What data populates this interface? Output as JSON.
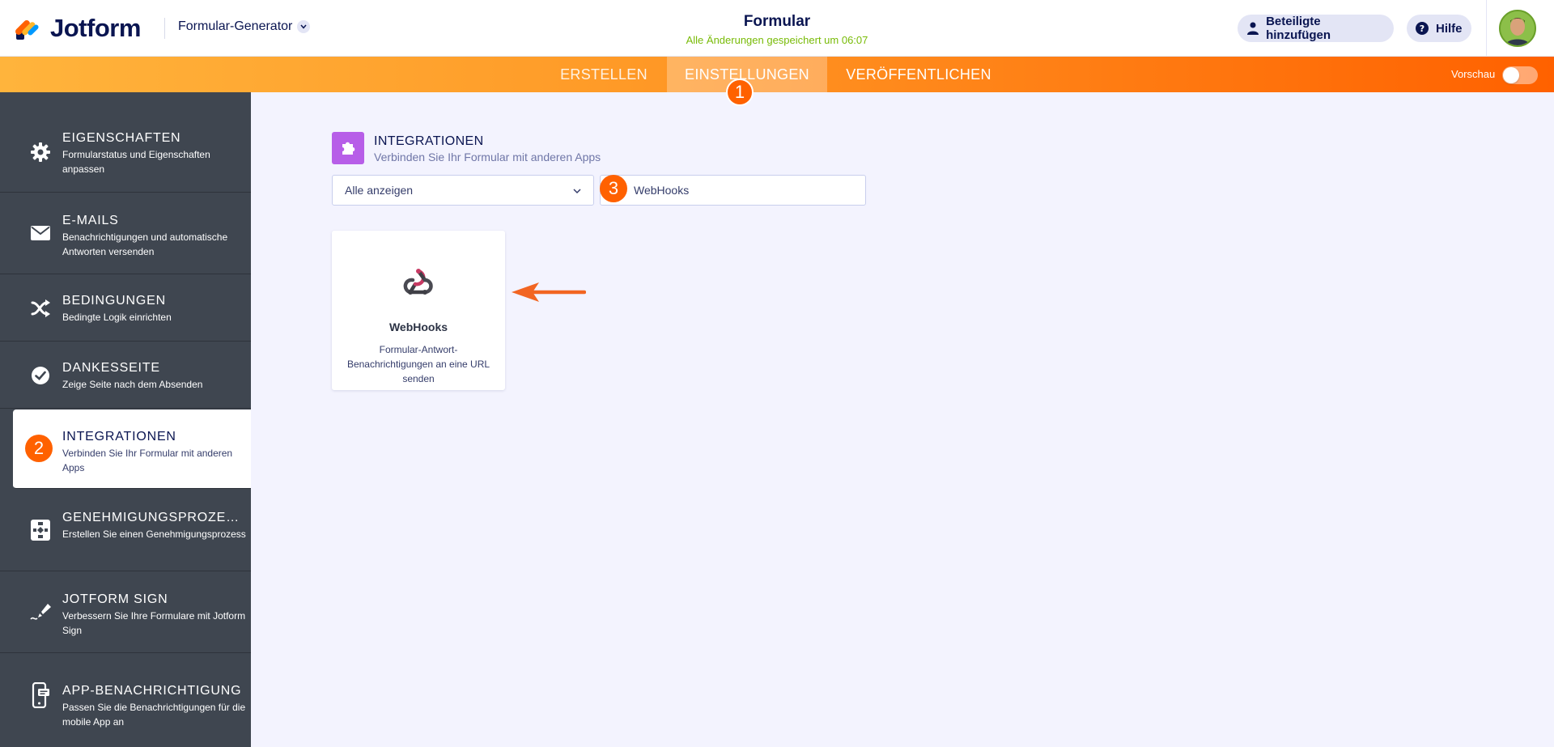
{
  "header": {
    "brand": "Jotform",
    "builder_menu": "Formular-Generator",
    "form_title": "Formular",
    "save_status": "Alle Änderungen gespeichert um 06:07",
    "add_participants": "Beteiligte hinzufügen",
    "help": "Hilfe"
  },
  "nav": {
    "tabs": [
      {
        "label": "ERSTELLEN"
      },
      {
        "label": "EINSTELLUNGEN"
      },
      {
        "label": "VERÖFFENTLICHEN"
      }
    ],
    "active_tab": "EINSTELLUNGEN",
    "preview_label": "Vorschau",
    "preview_on": false
  },
  "annotations": {
    "step1": "1",
    "step2": "2",
    "step3": "3"
  },
  "sidebar": {
    "items": [
      {
        "title": "EIGENSCHAFTEN",
        "desc": "Formularstatus und Eigenschaften anpassen",
        "icon": "gear-icon"
      },
      {
        "title": "E-MAILS",
        "desc": "Benachrichtigungen und automatische Antworten versenden",
        "icon": "envelope-icon"
      },
      {
        "title": "BEDINGUNGEN",
        "desc": "Bedingte Logik einrichten",
        "icon": "shuffle-icon"
      },
      {
        "title": "DANKESSEITE",
        "desc": "Zeige Seite nach dem Absenden",
        "icon": "check-circle-icon"
      },
      {
        "title": "INTEGRATIONEN",
        "desc": "Verbinden Sie Ihr Formular mit anderen Apps",
        "icon": "puzzle-icon"
      },
      {
        "title": "GENEHMIGUNGSPROZES...",
        "desc": "Erstellen Sie einen Genehmigungsprozess",
        "icon": "flow-icon"
      },
      {
        "title": "JOTFORM SIGN",
        "desc": "Verbessern Sie Ihre Formulare mit Jotform Sign",
        "icon": "pen-icon"
      },
      {
        "title": "APP-BENACHRICHTIGUNG",
        "desc": "Passen Sie die Benachrichtigungen für die mobile App an",
        "icon": "mobile-icon"
      }
    ],
    "active_index": 4
  },
  "main": {
    "section_title": "INTEGRATIONEN",
    "section_sub": "Verbinden Sie Ihr Formular mit anderen Apps",
    "filter_value": "Alle anzeigen",
    "search_value": "WebHooks",
    "results": [
      {
        "name": "WebHooks",
        "desc": "Formular-Antwort-Benachrichtigungen an eine URL senden",
        "icon": "webhooks-icon"
      }
    ]
  },
  "colors": {
    "accent": "#ff6100",
    "sidebar_bg": "#3f4650",
    "integration_icon_bg": "#b75ee8",
    "saved_text": "#78bb07"
  }
}
